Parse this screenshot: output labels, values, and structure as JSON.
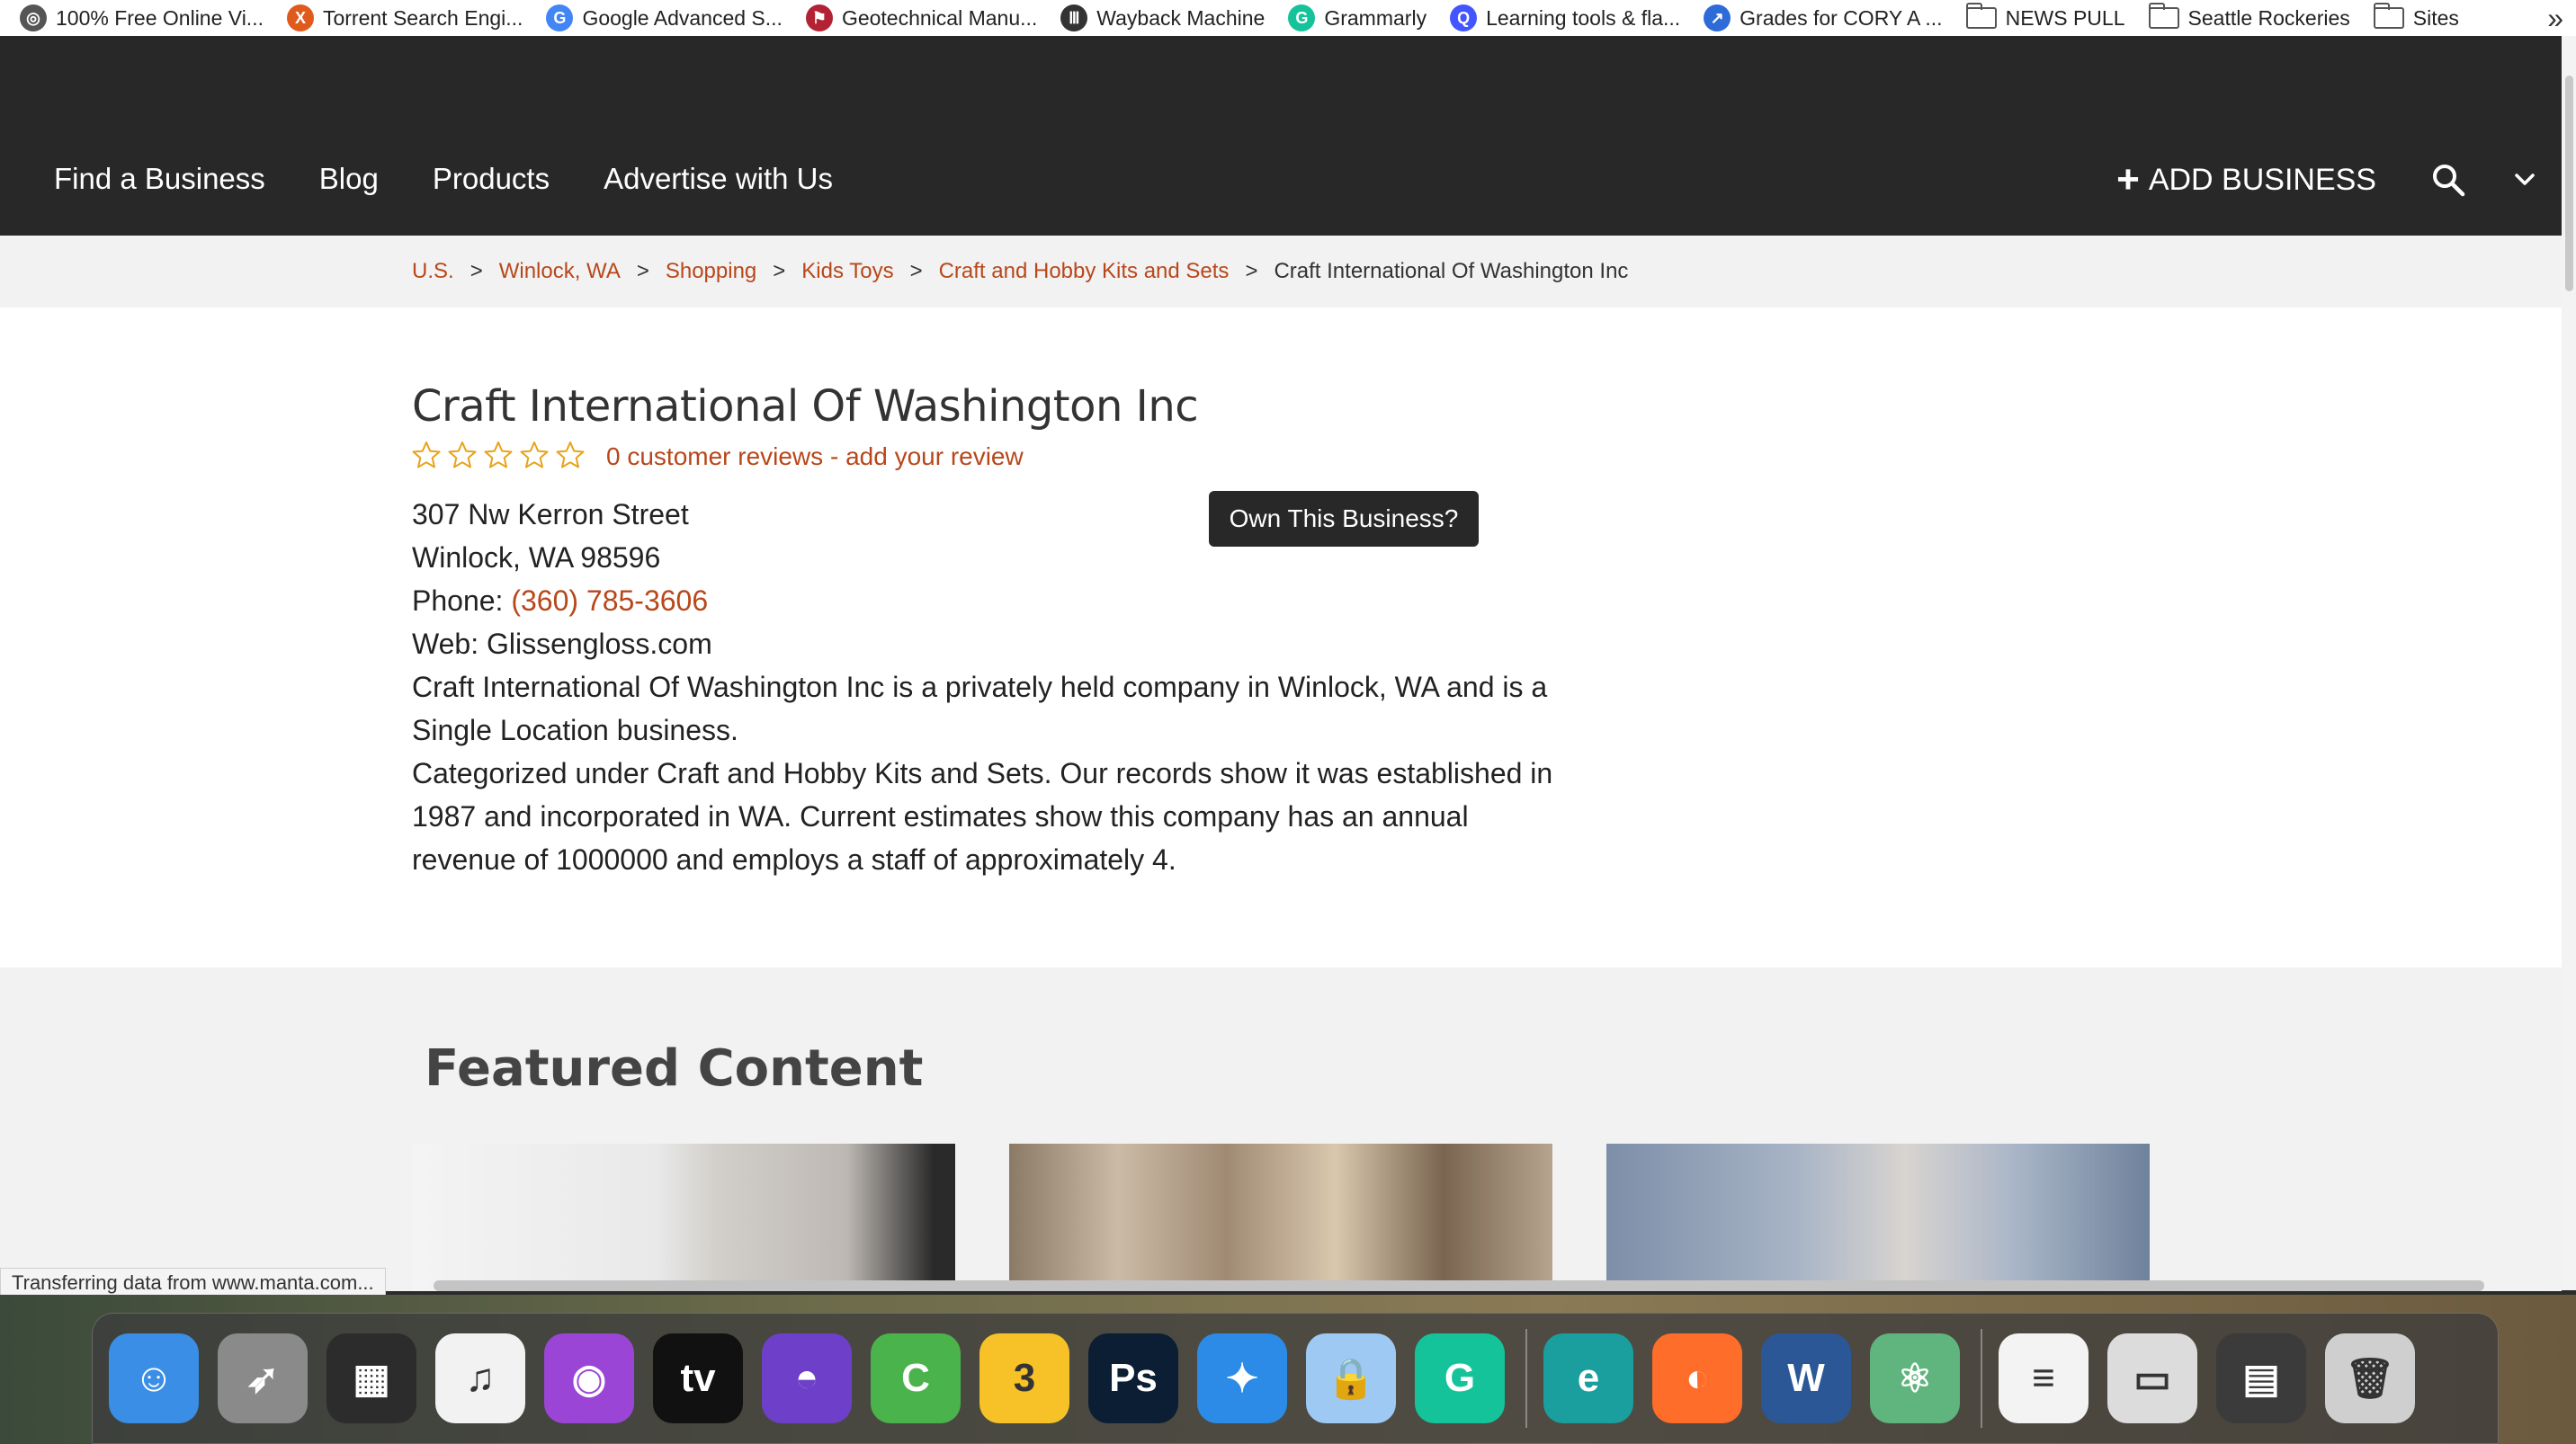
{
  "bookmarks": [
    {
      "label": "100% Free Online Vi...",
      "icon": "globe-icon",
      "color": "#555555",
      "glyph": "◎"
    },
    {
      "label": "Torrent Search Engi...",
      "icon": "x-logo-icon",
      "color": "#e05a1c",
      "glyph": "X"
    },
    {
      "label": "Google Advanced S...",
      "icon": "google-icon",
      "color": "#4285f4",
      "glyph": "G"
    },
    {
      "label": "Geotechnical Manu...",
      "icon": "flag-icon",
      "color": "#b22234",
      "glyph": "⚑"
    },
    {
      "label": "Wayback Machine",
      "icon": "archive-icon",
      "color": "#333333",
      "glyph": "Ⅲ"
    },
    {
      "label": "Grammarly",
      "icon": "grammarly-icon",
      "color": "#15c39a",
      "glyph": "G"
    },
    {
      "label": "Learning tools & fla...",
      "icon": "quizlet-icon",
      "color": "#4255ff",
      "glyph": "Q"
    },
    {
      "label": "Grades for CORY A ...",
      "icon": "canvas-icon",
      "color": "#2d6bd8",
      "glyph": "↗"
    }
  ],
  "bookmark_folders": [
    "NEWS PULL",
    "Seattle Rockeries",
    "Sites"
  ],
  "bookmarks_overflow": "»",
  "nav": {
    "items": [
      "Find a Business",
      "Blog",
      "Products",
      "Advertise with Us"
    ],
    "add_business": "ADD BUSINESS"
  },
  "breadcrumb": {
    "links": [
      "U.S.",
      "Winlock, WA",
      "Shopping",
      "Kids Toys",
      "Craft and Hobby Kits and Sets"
    ],
    "separator": ">",
    "current": "Craft International Of Washington Inc"
  },
  "business": {
    "name": "Craft International Of Washington Inc",
    "rating": 0,
    "stars_total": 5,
    "reviews_text": "0 customer reviews - add your review",
    "street": "307 Nw Kerron Street",
    "city_line": "Winlock, WA 98596",
    "phone_label": "Phone: ",
    "phone": "(360) 785-3606",
    "web": "Web: Glissengloss.com",
    "description_1": "Craft International Of Washington Inc is a privately held company in Winlock, WA and is a Single Location business.",
    "description_2": "Categorized under Craft and Hobby Kits and Sets. Our records show it was established in 1987 and incorporated in WA. Current estimates show this company has an annual revenue of 1000000 and employs a staff of approximately 4.",
    "own_button": "Own This Business?"
  },
  "featured": {
    "title": "Featured Content"
  },
  "status_text": "Transferring data from www.manta.com...",
  "dock": [
    {
      "name": "finder-icon",
      "color": "#3a8ee6",
      "glyph": "☺"
    },
    {
      "name": "launchpad-icon",
      "color": "#8a8a8a",
      "glyph": "➶"
    },
    {
      "name": "photo-slideshow-icon",
      "color": "#2c2c2c",
      "glyph": "▦"
    },
    {
      "name": "music-icon",
      "color": "#f2f2f2",
      "glyph": "♫"
    },
    {
      "name": "podcasts-icon",
      "color": "#9b45d6",
      "glyph": "◉"
    },
    {
      "name": "apple-tv-icon",
      "color": "#111111",
      "glyph": "tv"
    },
    {
      "name": "github-icon",
      "color": "#6e40c9",
      "glyph": "◓"
    },
    {
      "name": "camtasia-icon",
      "color": "#4bb34b",
      "glyph": "C"
    },
    {
      "name": "numbers-3-icon",
      "color": "#f6c228",
      "glyph": "3"
    },
    {
      "name": "photoshop-icon",
      "color": "#0b1e33",
      "glyph": "Ps"
    },
    {
      "name": "safari-icon",
      "color": "#2b8be6",
      "glyph": "✦"
    },
    {
      "name": "keychain-lock-icon",
      "color": "#9ec9f2",
      "glyph": "🔒"
    },
    {
      "name": "grammarly-app-icon",
      "color": "#15c39a",
      "glyph": "G"
    },
    {
      "name": "eset-icon",
      "color": "#1a9e9e",
      "glyph": "e"
    },
    {
      "name": "firefox-icon",
      "color": "#ff6d2a",
      "glyph": "◐"
    },
    {
      "name": "word-icon",
      "color": "#2b5797",
      "glyph": "W"
    },
    {
      "name": "atom-icon",
      "color": "#5fb57d",
      "glyph": "⚛"
    },
    {
      "name": "docx-file-icon",
      "color": "#f3f3f3",
      "glyph": "≡"
    },
    {
      "name": "browser-window-icon",
      "color": "#dcdcdc",
      "glyph": "▭"
    },
    {
      "name": "downloads-folder-icon",
      "color": "#3b3b3b",
      "glyph": "▤"
    },
    {
      "name": "trash-icon",
      "color": "#cfcfcf",
      "glyph": "🗑"
    }
  ],
  "colors": {
    "header_bg": "#282828",
    "link": "#b8471a",
    "star": "#e8a317"
  }
}
